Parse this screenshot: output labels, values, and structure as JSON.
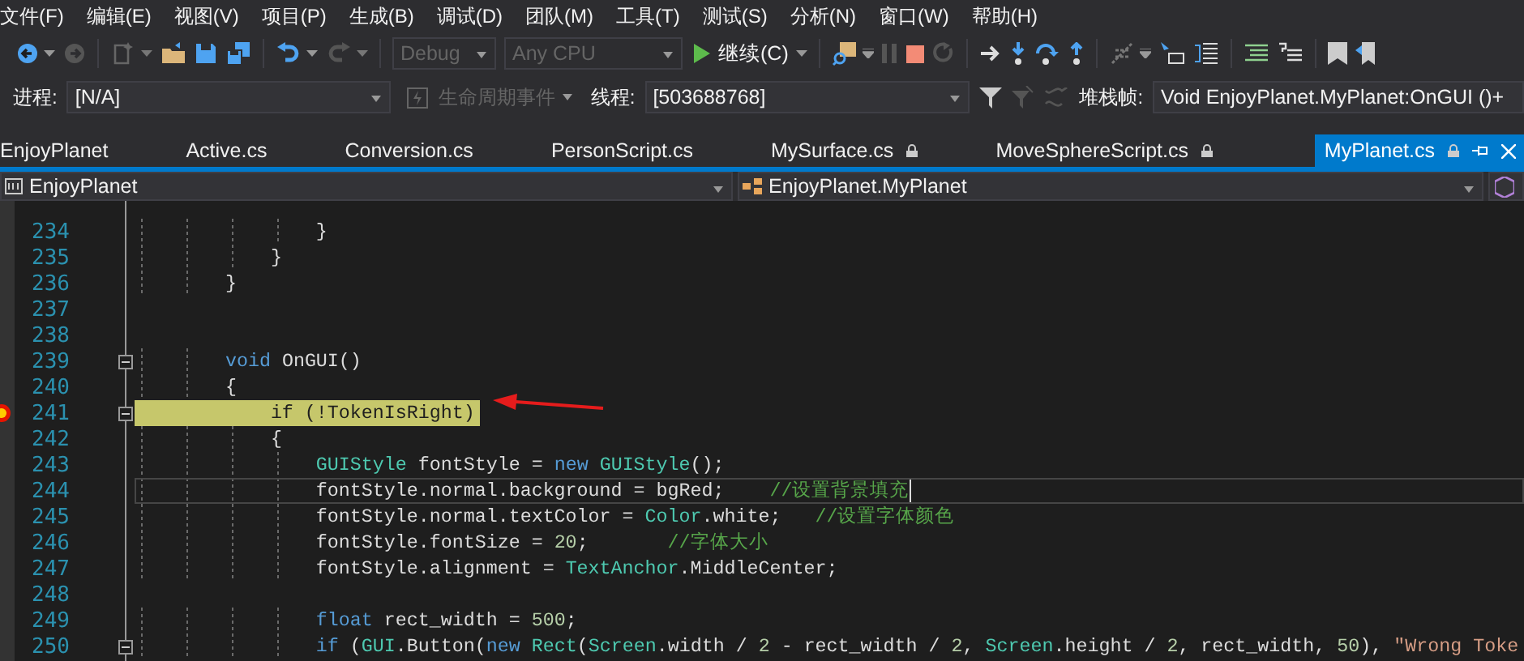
{
  "menu": [
    "文件(F)",
    "编辑(E)",
    "视图(V)",
    "项目(P)",
    "生成(B)",
    "调试(D)",
    "团队(M)",
    "工具(T)",
    "测试(S)",
    "分析(N)",
    "窗口(W)",
    "帮助(H)"
  ],
  "toolbar": {
    "configuration": {
      "value": "Debug",
      "disabled": true
    },
    "platform": {
      "value": "Any CPU",
      "disabled": true
    },
    "continue_label": "继续(C)"
  },
  "debug_location": {
    "process_label": "进程:",
    "process": "[N/A]",
    "lifecycle_events": {
      "label": "生命周期事件",
      "disabled": true
    },
    "thread_label": "线程:",
    "thread": "[503688768]",
    "stack_frame_label": "堆栈帧:",
    "stack_frame": "Void EnjoyPlanet.MyPlanet:OnGUI ()+"
  },
  "tabs": [
    {
      "label": "EnjoyPlanet",
      "locked": false,
      "selected": false
    },
    {
      "label": "Active.cs",
      "locked": false,
      "selected": false
    },
    {
      "label": "Conversion.cs",
      "locked": false,
      "selected": false
    },
    {
      "label": "PersonScript.cs",
      "locked": false,
      "selected": false
    },
    {
      "label": "MySurface.cs",
      "locked": true,
      "selected": false
    },
    {
      "label": "MoveSphereScript.cs",
      "locked": true,
      "selected": false
    },
    {
      "label": "MyPlanet.cs",
      "locked": true,
      "selected": true
    }
  ],
  "navigation": {
    "project": "EnjoyPlanet",
    "type": "EnjoyPlanet.MyPlanet"
  },
  "code_lines": [
    {
      "number": "234",
      "executing": false,
      "caret": false,
      "collapsible": false,
      "tokens": [
        {
          "kind": "plain",
          "text": "                }"
        }
      ]
    },
    {
      "number": "235",
      "executing": false,
      "caret": false,
      "collapsible": false,
      "tokens": [
        {
          "kind": "plain",
          "text": "            }"
        }
      ]
    },
    {
      "number": "236",
      "executing": false,
      "caret": false,
      "collapsible": false,
      "tokens": [
        {
          "kind": "plain",
          "text": "        }"
        }
      ]
    },
    {
      "number": "237",
      "executing": false,
      "caret": false,
      "collapsible": false
    },
    {
      "number": "238",
      "executing": false,
      "caret": false,
      "collapsible": false
    },
    {
      "number": "239",
      "executing": false,
      "caret": false,
      "collapsible": true,
      "tokens": [
        {
          "kind": "keyword",
          "text": "        void"
        },
        {
          "kind": "plain",
          "text": " OnGUI()"
        }
      ]
    },
    {
      "number": "240",
      "executing": false,
      "caret": false,
      "collapsible": false,
      "tokens": [
        {
          "kind": "plain",
          "text": "        {"
        }
      ]
    },
    {
      "number": "241",
      "executing": true,
      "caret": false,
      "collapsible": true,
      "tokens": [
        {
          "kind": "plain",
          "text": "            if (!TokenIsRight)"
        }
      ]
    },
    {
      "number": "242",
      "executing": false,
      "caret": false,
      "collapsible": false,
      "tokens": [
        {
          "kind": "plain",
          "text": "            {"
        }
      ]
    },
    {
      "number": "243",
      "executing": false,
      "caret": false,
      "collapsible": false,
      "tokens": [
        {
          "kind": "type",
          "text": "                GUIStyle"
        },
        {
          "kind": "plain",
          "text": " fontStyle = "
        },
        {
          "kind": "keyword",
          "text": "new"
        },
        {
          "kind": "type",
          "text": " GUIStyle"
        },
        {
          "kind": "plain",
          "text": "();"
        }
      ]
    },
    {
      "number": "244",
      "executing": false,
      "caret": true,
      "collapsible": false,
      "tokens": [
        {
          "kind": "plain",
          "text": "                fontStyle.normal.background = bgRed;    "
        },
        {
          "kind": "comment",
          "text": "//设置背景填充"
        }
      ]
    },
    {
      "number": "245",
      "executing": false,
      "caret": false,
      "collapsible": false,
      "tokens": [
        {
          "kind": "plain",
          "text": "                fontStyle.normal.textColor = "
        },
        {
          "kind": "type",
          "text": "Color"
        },
        {
          "kind": "plain",
          "text": ".white;   "
        },
        {
          "kind": "comment",
          "text": "//设置字体颜色"
        }
      ]
    },
    {
      "number": "246",
      "executing": false,
      "caret": false,
      "collapsible": false,
      "tokens": [
        {
          "kind": "plain",
          "text": "                fontStyle.fontSize = "
        },
        {
          "kind": "number",
          "text": "20"
        },
        {
          "kind": "plain",
          "text": ";       "
        },
        {
          "kind": "comment",
          "text": "//字体大小"
        }
      ]
    },
    {
      "number": "247",
      "executing": false,
      "caret": false,
      "collapsible": false,
      "tokens": [
        {
          "kind": "plain",
          "text": "                fontStyle.alignment = "
        },
        {
          "kind": "type",
          "text": "TextAnchor"
        },
        {
          "kind": "plain",
          "text": ".MiddleCenter;"
        }
      ]
    },
    {
      "number": "248",
      "executing": false,
      "caret": false,
      "collapsible": false
    },
    {
      "number": "249",
      "executing": false,
      "caret": false,
      "collapsible": false,
      "tokens": [
        {
          "kind": "keyword",
          "text": "                float"
        },
        {
          "kind": "plain",
          "text": " rect_width = "
        },
        {
          "kind": "number",
          "text": "500"
        },
        {
          "kind": "plain",
          "text": ";"
        }
      ]
    },
    {
      "number": "250",
      "executing": false,
      "caret": false,
      "collapsible": true,
      "tokens": [
        {
          "kind": "keyword",
          "text": "                if"
        },
        {
          "kind": "plain",
          "text": " ("
        },
        {
          "kind": "type",
          "text": "GUI"
        },
        {
          "kind": "plain",
          "text": ".Button("
        },
        {
          "kind": "keyword",
          "text": "new"
        },
        {
          "kind": "type",
          "text": " Rect"
        },
        {
          "kind": "plain",
          "text": "("
        },
        {
          "kind": "type",
          "text": "Screen"
        },
        {
          "kind": "plain",
          "text": ".width / "
        },
        {
          "kind": "number",
          "text": "2"
        },
        {
          "kind": "plain",
          "text": " - rect_width / "
        },
        {
          "kind": "number",
          "text": "2"
        },
        {
          "kind": "plain",
          "text": ", "
        },
        {
          "kind": "type",
          "text": "Screen"
        },
        {
          "kind": "plain",
          "text": ".height / "
        },
        {
          "kind": "number",
          "text": "2"
        },
        {
          "kind": "plain",
          "text": ", rect_width, "
        },
        {
          "kind": "number",
          "text": "50"
        },
        {
          "kind": "plain",
          "text": "), "
        },
        {
          "kind": "string",
          "text": "\"Wrong Toke"
        }
      ]
    }
  ]
}
